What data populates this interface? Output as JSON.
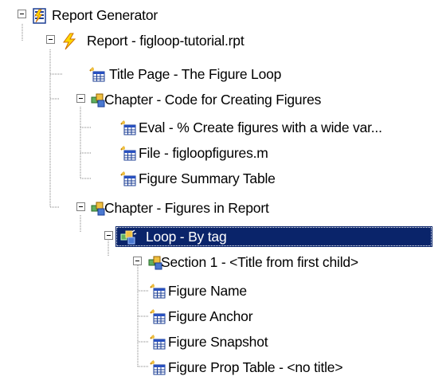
{
  "tree": {
    "nodes": [
      {
        "label": "Report Generator",
        "icon": "report-generator-icon",
        "expanded": true
      },
      {
        "label": "Report - figloop-tutorial.rpt",
        "icon": "report-lightning-icon",
        "expanded": true
      },
      {
        "label": "Title Page - The Figure Loop",
        "icon": "component-table-icon"
      },
      {
        "label": "Chapter - Code for Creating Figures",
        "icon": "chapter-icon",
        "expanded": true
      },
      {
        "label": "Eval - % Create figures with a wide var...",
        "icon": "component-table-icon"
      },
      {
        "label": "File - figloopfigures.m",
        "icon": "component-table-icon"
      },
      {
        "label": "Figure Summary Table",
        "icon": "component-table-icon"
      },
      {
        "label": "Chapter - Figures in Report",
        "icon": "chapter-icon",
        "expanded": true
      },
      {
        "label": "Loop - By tag",
        "icon": "loop-icon",
        "expanded": true,
        "selected": true
      },
      {
        "label": "Section 1 - <Title from first child>",
        "icon": "chapter-icon",
        "expanded": true
      },
      {
        "label": "Figure Name",
        "icon": "component-table-icon"
      },
      {
        "label": "Figure Anchor",
        "icon": "component-table-icon"
      },
      {
        "label": "Figure Snapshot",
        "icon": "component-table-icon"
      },
      {
        "label": "Figure Prop Table - <no title>",
        "icon": "component-table-icon"
      }
    ]
  },
  "colors": {
    "selection_bg": "#0a246a",
    "selection_text": "#ffffff",
    "tree_lines": "#808080"
  }
}
